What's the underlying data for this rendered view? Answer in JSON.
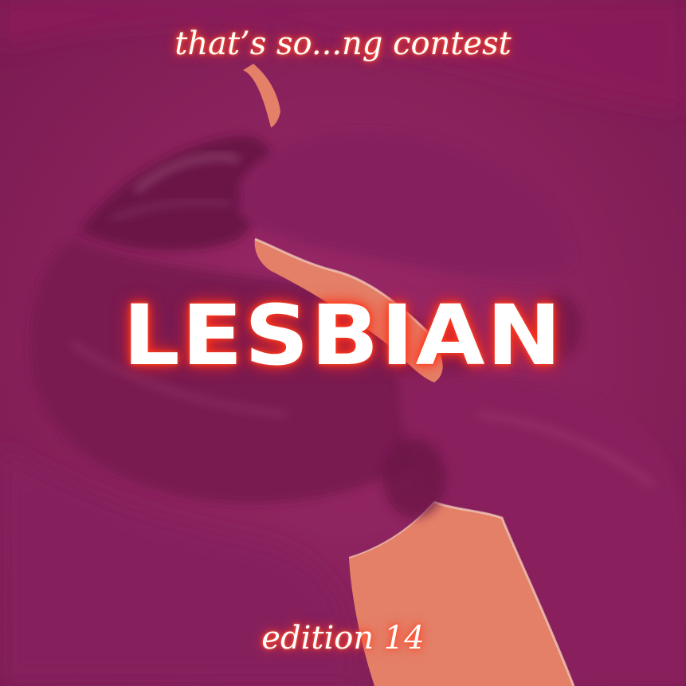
{
  "poster": {
    "top_title": "that’s so...ng contest",
    "main_title": "LESBIAN",
    "bottom_title": "edition 14"
  },
  "colors": {
    "background": "#8e2360",
    "shadow": "#6e1548",
    "highlight": "#f08a6c",
    "glow": "#ff3a1a",
    "text": "#ffffff"
  }
}
